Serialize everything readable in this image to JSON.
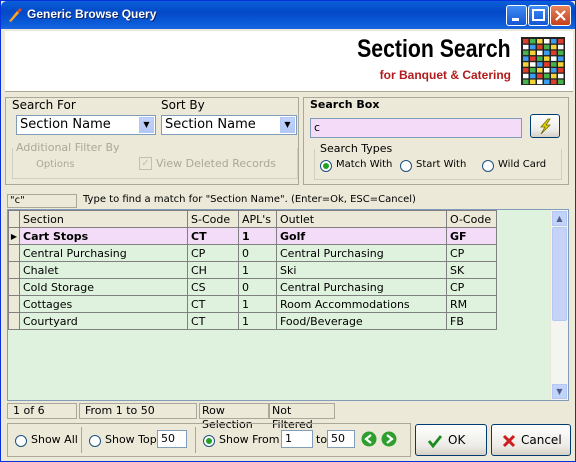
{
  "window": {
    "title": "Generic Browse Query"
  },
  "header": {
    "title": "Section Search",
    "subtitle": "for Banquet & Catering"
  },
  "search_for": {
    "legend": "Search For",
    "value": "Section Name"
  },
  "sort_by": {
    "legend": "Sort By",
    "value": "Section Name"
  },
  "additional_filter": {
    "legend": "Additional Filter By",
    "options_label": "Options",
    "view_deleted_label": "View Deleted Records"
  },
  "search_box": {
    "legend": "Search Box",
    "value": "c"
  },
  "search_types": {
    "legend": "Search Types",
    "options": [
      "Match With",
      "Start With",
      "Wild Card"
    ],
    "selected": "Match With"
  },
  "hint": {
    "query": "\"c\"",
    "text": "Type to find a match for \"Section Name\". (Enter=Ok, ESC=Cancel)"
  },
  "grid": {
    "columns": [
      "Section",
      "S-Code",
      "APL's",
      "Outlet",
      "O-Code"
    ],
    "rows": [
      [
        "Cart Stops",
        "CT",
        "1",
        "Golf",
        "GF"
      ],
      [
        "Central Purchasing",
        "CP",
        "0",
        "Central Purchasing",
        "CP"
      ],
      [
        "Chalet",
        "CH",
        "1",
        "Ski",
        "SK"
      ],
      [
        "Cold Storage",
        "CS",
        "0",
        "Central Purchasing",
        "CP"
      ],
      [
        "Cottages",
        "CT",
        "1",
        "Room Accommodations",
        "RM"
      ],
      [
        "Courtyard",
        "CT",
        "1",
        "Food/Beverage",
        "FB"
      ]
    ],
    "selected_row": 0
  },
  "status": {
    "position": "1 of 6",
    "range": "From 1 to 50",
    "selection": "Row Selection",
    "filter": "Not Filtered"
  },
  "footer": {
    "show_all_label": "Show All",
    "show_top_label": "Show Top",
    "show_top_value": "50",
    "show_from_label": "Show From",
    "from_value": "1",
    "to_label": "to",
    "to_value": "50",
    "ok_label": "OK",
    "cancel_label": "Cancel"
  },
  "colors": {
    "selected_row": "#f2dcf7",
    "grid_bg": "#dff2dd",
    "search_box_bg": "#f4dcf8",
    "subtitle": "#b21b1b"
  }
}
